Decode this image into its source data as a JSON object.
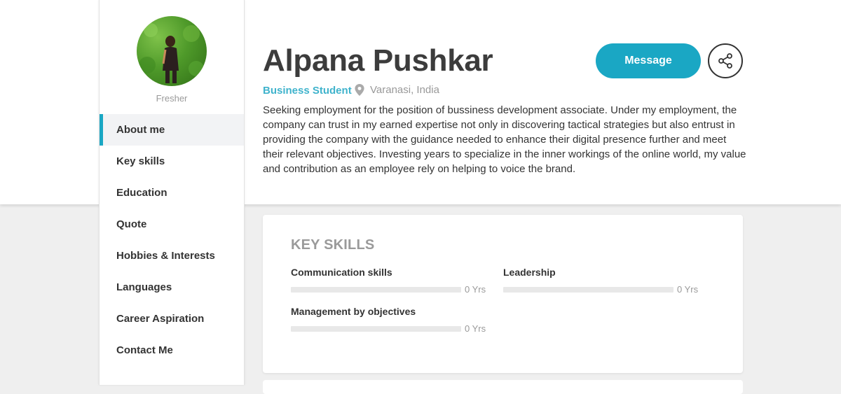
{
  "profile": {
    "name": "Alpana Pushkar",
    "status": "Fresher",
    "role": "Business Student",
    "location": "Varanasi, India",
    "bio": "Seeking employment for the position of bussiness development associate. Under my employment, the company can trust in my earned expertise not only in discovering tactical strategies but also entrust in providing the company with the guidance needed to enhance their digital presence further and meet their relevant objectives. Investing years to specialize in the inner workings of the online world, my value and contribution as an employee rely on helping to voice the brand."
  },
  "actions": {
    "message_label": "Message",
    "share_icon": "share-icon"
  },
  "nav": {
    "items": [
      {
        "label": "About me",
        "active": true
      },
      {
        "label": "Key skills"
      },
      {
        "label": "Education"
      },
      {
        "label": "Quote"
      },
      {
        "label": "Hobbies & Interests"
      },
      {
        "label": "Languages"
      },
      {
        "label": "Career Aspiration"
      },
      {
        "label": "Contact Me"
      }
    ]
  },
  "key_skills": {
    "title": "KEY SKILLS",
    "items": [
      {
        "name": "Communication skills",
        "years": "0 Yrs",
        "level": 0
      },
      {
        "name": "Leadership",
        "years": "0 Yrs",
        "level": 0
      },
      {
        "name": "Management by objectives",
        "years": "0 Yrs",
        "level": 0
      }
    ]
  },
  "colors": {
    "accent": "#1aa7c4",
    "role_text": "#3fb3cc",
    "background": "#efefef"
  }
}
